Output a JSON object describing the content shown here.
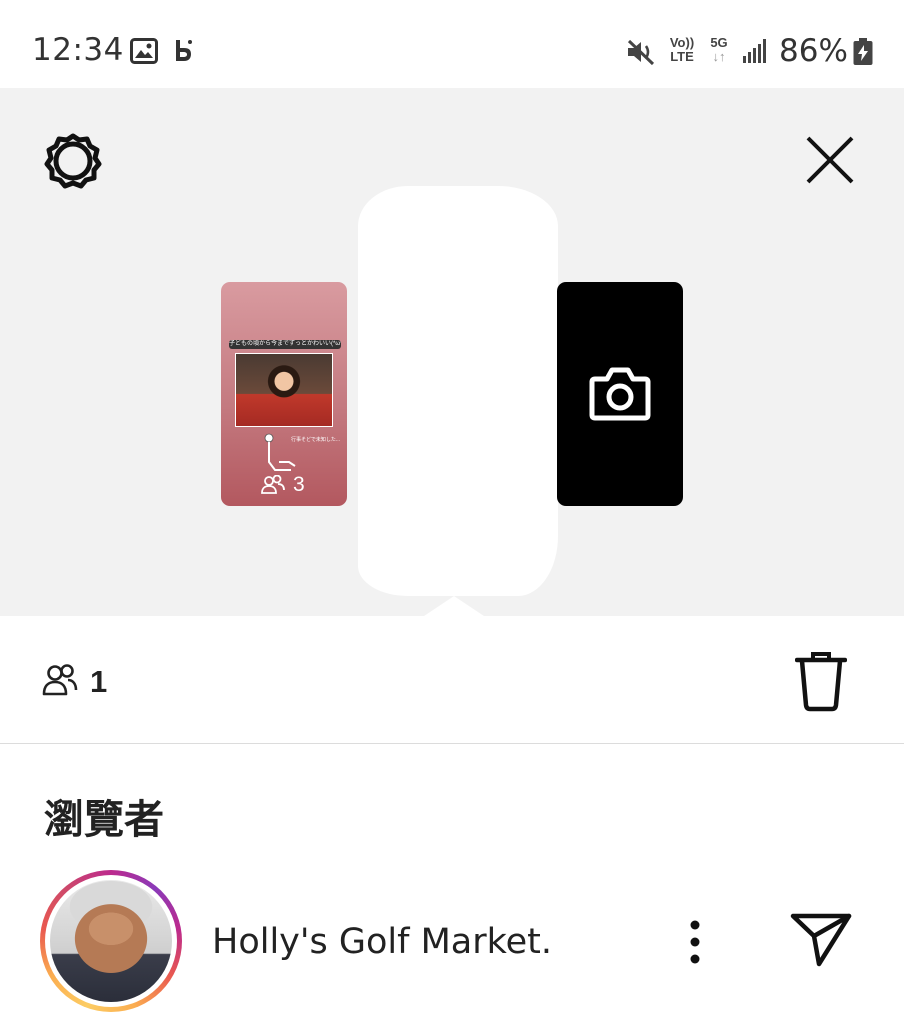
{
  "status_bar": {
    "time": "12:34",
    "volte_top": "Vo))",
    "volte_bottom": "LTE",
    "network_top": "5G",
    "network_bottom": "↓↑",
    "battery": "86%",
    "icons": [
      "gallery-icon",
      "b-app-icon",
      "mute-icon",
      "signal-icon",
      "battery-charging-icon"
    ]
  },
  "story": {
    "left_thumb": {
      "caption": "子どもの頃から今までずっとかわいい(*ω*)",
      "note": "行事そどで未知した...",
      "viewer_count": "3"
    },
    "right_thumb": {
      "icon": "camera-icon"
    }
  },
  "info": {
    "viewer_count": "1"
  },
  "viewers_section": {
    "title": "瀏覽者",
    "items": [
      {
        "name": "Holly's Golf Market."
      }
    ]
  },
  "colors": {
    "story_bg": "#f2f2f2",
    "ring_gradient_start": "#fccc63",
    "ring_gradient_end": "#bc2a8d"
  }
}
